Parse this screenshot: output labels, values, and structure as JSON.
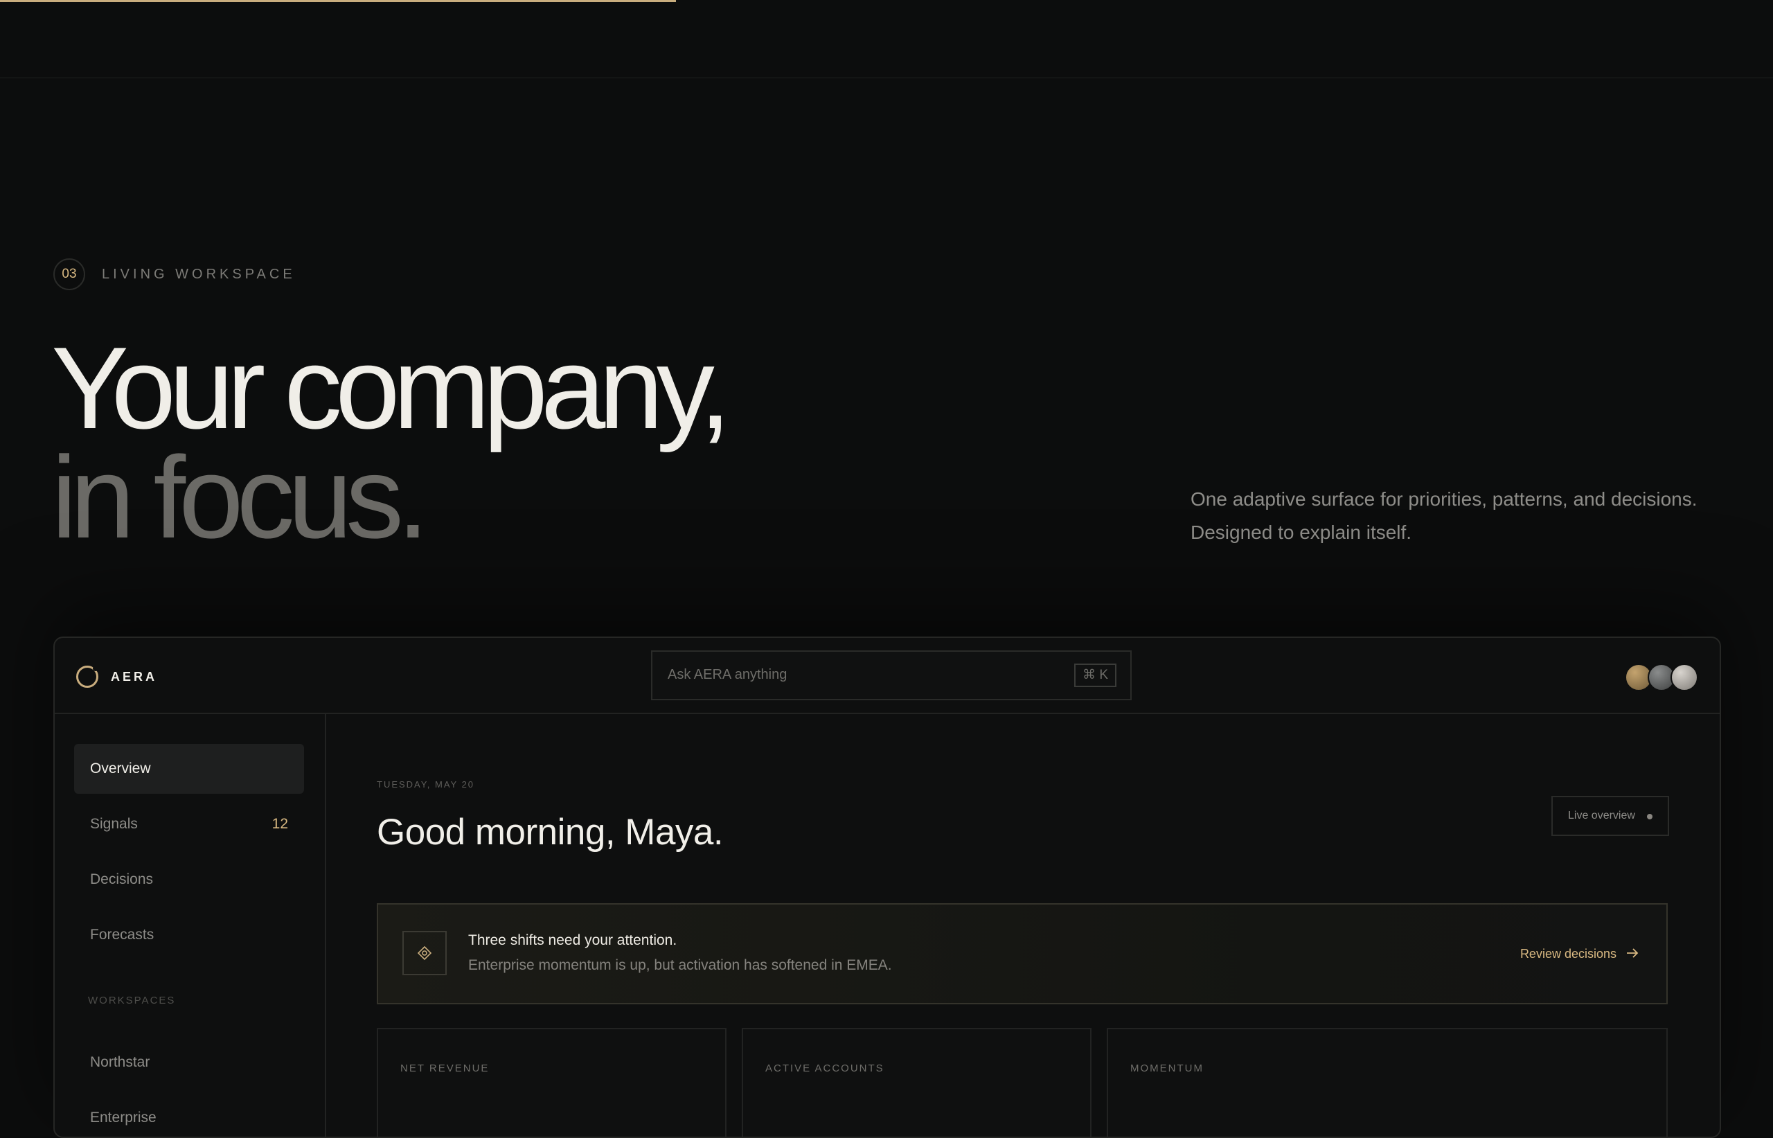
{
  "section": {
    "number": "03",
    "label": "LIVING WORKSPACE"
  },
  "hero": {
    "line1": "Your company,",
    "line2": "in focus.",
    "subtitle_line1": "One adaptive surface for priorities, patterns, and decisions.",
    "subtitle_line2": "Designed to explain itself."
  },
  "app": {
    "brand": "AERA",
    "search": {
      "placeholder": "Ask AERA anything",
      "shortcut": "⌘ K"
    },
    "avatars": [
      "avatar-1",
      "avatar-2",
      "avatar-3"
    ],
    "sidebar": {
      "items": [
        {
          "label": "Overview",
          "active": true
        },
        {
          "label": "Signals",
          "count": "12"
        },
        {
          "label": "Decisions"
        },
        {
          "label": "Forecasts"
        }
      ],
      "workspaces_label": "WORKSPACES",
      "workspaces": [
        {
          "label": "Northstar"
        },
        {
          "label": "Enterprise"
        }
      ]
    },
    "main": {
      "date": "TUESDAY, MAY 20",
      "greeting": "Good morning, Maya.",
      "live_label": "Live overview",
      "alert": {
        "title": "Three shifts need your attention.",
        "text": "Enterprise momentum is up, but activation has softened in EMEA.",
        "action": "Review decisions"
      },
      "cards": [
        {
          "label": "NET REVENUE"
        },
        {
          "label": "ACTIVE ACCOUNTS"
        },
        {
          "label": "MOMENTUM"
        }
      ]
    }
  },
  "colors": {
    "accent": "#d9b982",
    "background": "#0c0d0d",
    "panel": "#0e0f0f"
  },
  "icons": [
    "logo-ring-icon",
    "signal-diamond-icon",
    "arrow-right-icon"
  ]
}
